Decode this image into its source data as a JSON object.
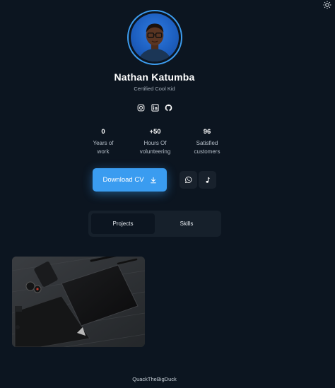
{
  "profile": {
    "name": "Nathan Katumba",
    "subtitle": "Certified Cool Kid"
  },
  "socials": [
    {
      "icon": "instagram-icon"
    },
    {
      "icon": "linkedin-icon"
    },
    {
      "icon": "github-icon"
    }
  ],
  "stats": [
    {
      "value": "0",
      "label_line1": "Years of",
      "label_line2": "work"
    },
    {
      "value": "+50",
      "label_line1": "Hours Of",
      "label_line2": "volunteering"
    },
    {
      "value": "96",
      "label_line1": "Satisfied",
      "label_line2": "customers"
    }
  ],
  "actions": {
    "download_label": "Download CV",
    "whatsapp_icon": "whatsapp-icon",
    "music_icon": "music-note-icon"
  },
  "tabs": [
    {
      "label": "Projects",
      "active": true
    },
    {
      "label": "Skills",
      "active": false
    }
  ],
  "footer": {
    "text": "QuackTheBigDuck"
  },
  "colors": {
    "background": "#0c1520",
    "accent": "#3a9cf0",
    "surface": "#16202b"
  }
}
